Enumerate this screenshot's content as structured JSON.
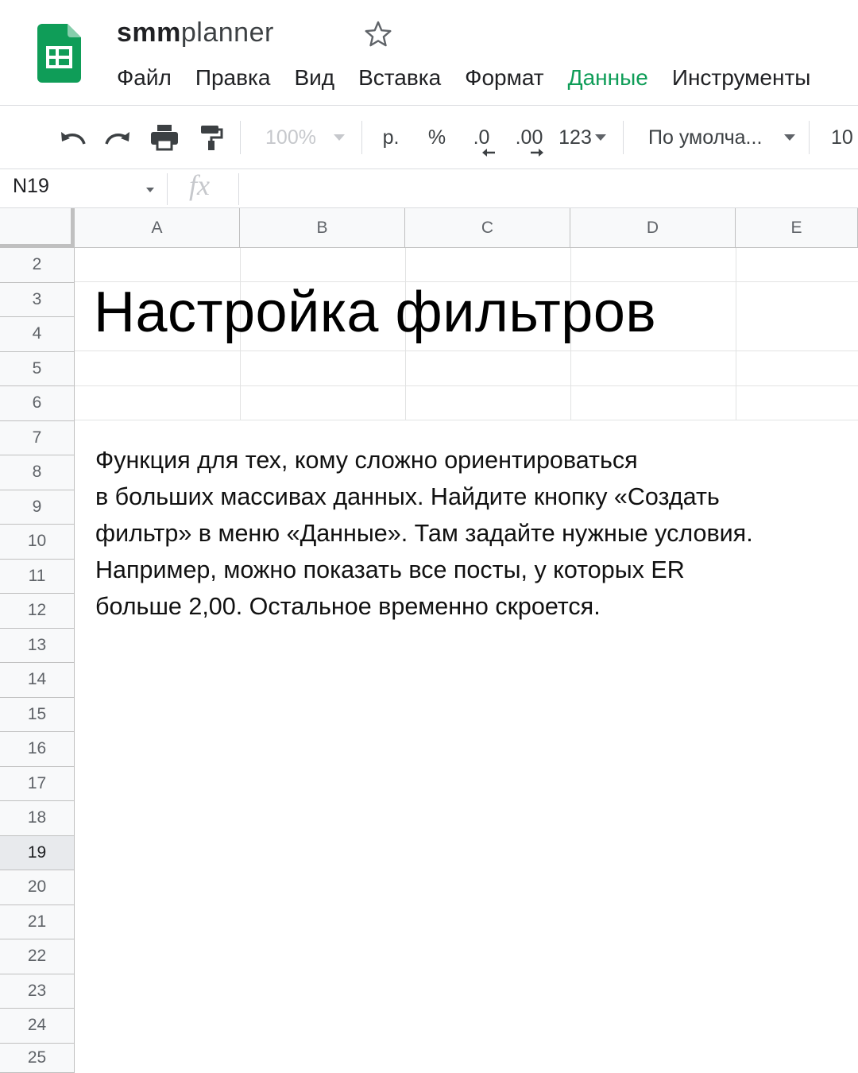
{
  "app": {
    "title_bold": "smm",
    "title_light": "planner",
    "logo_icon": "google-sheets-icon",
    "accent_color": "#0f9d58"
  },
  "menu": [
    {
      "label": "Файл",
      "active": false
    },
    {
      "label": "Правка",
      "active": false
    },
    {
      "label": "Вид",
      "active": false
    },
    {
      "label": "Вставка",
      "active": false
    },
    {
      "label": "Формат",
      "active": false
    },
    {
      "label": "Данные",
      "active": true
    },
    {
      "label": "Инструменты",
      "active": false
    }
  ],
  "toolbar": {
    "zoom": "100%",
    "currency": "р.",
    "percent": "%",
    "decrease_decimal": ".0",
    "increase_decimal": ".00",
    "more_formats": "123",
    "font": "По умолча...",
    "font_size": "10"
  },
  "formula_bar": {
    "cell_ref": "N19",
    "fx": "fx"
  },
  "grid": {
    "columns": [
      "A",
      "B",
      "C",
      "D",
      "E"
    ],
    "rows": [
      "2",
      "3",
      "4",
      "5",
      "6",
      "7",
      "8",
      "9",
      "10",
      "11",
      "12",
      "13",
      "14",
      "15",
      "16",
      "17",
      "18",
      "19",
      "20",
      "21",
      "22",
      "23",
      "24",
      "25"
    ],
    "selected_row": "19"
  },
  "content": {
    "heading": "Настройка фильтров",
    "body_lines": [
      "Функция для тех, кому сложно ориентироваться",
      "в больших массивах данных. Найдите кнопку «Создать",
      "фильтр» в меню «Данные». Там задайте нужные условия.",
      "Например, можно показать все посты, у которых ER",
      "больше 2,00. Остальное временно скроется."
    ]
  }
}
